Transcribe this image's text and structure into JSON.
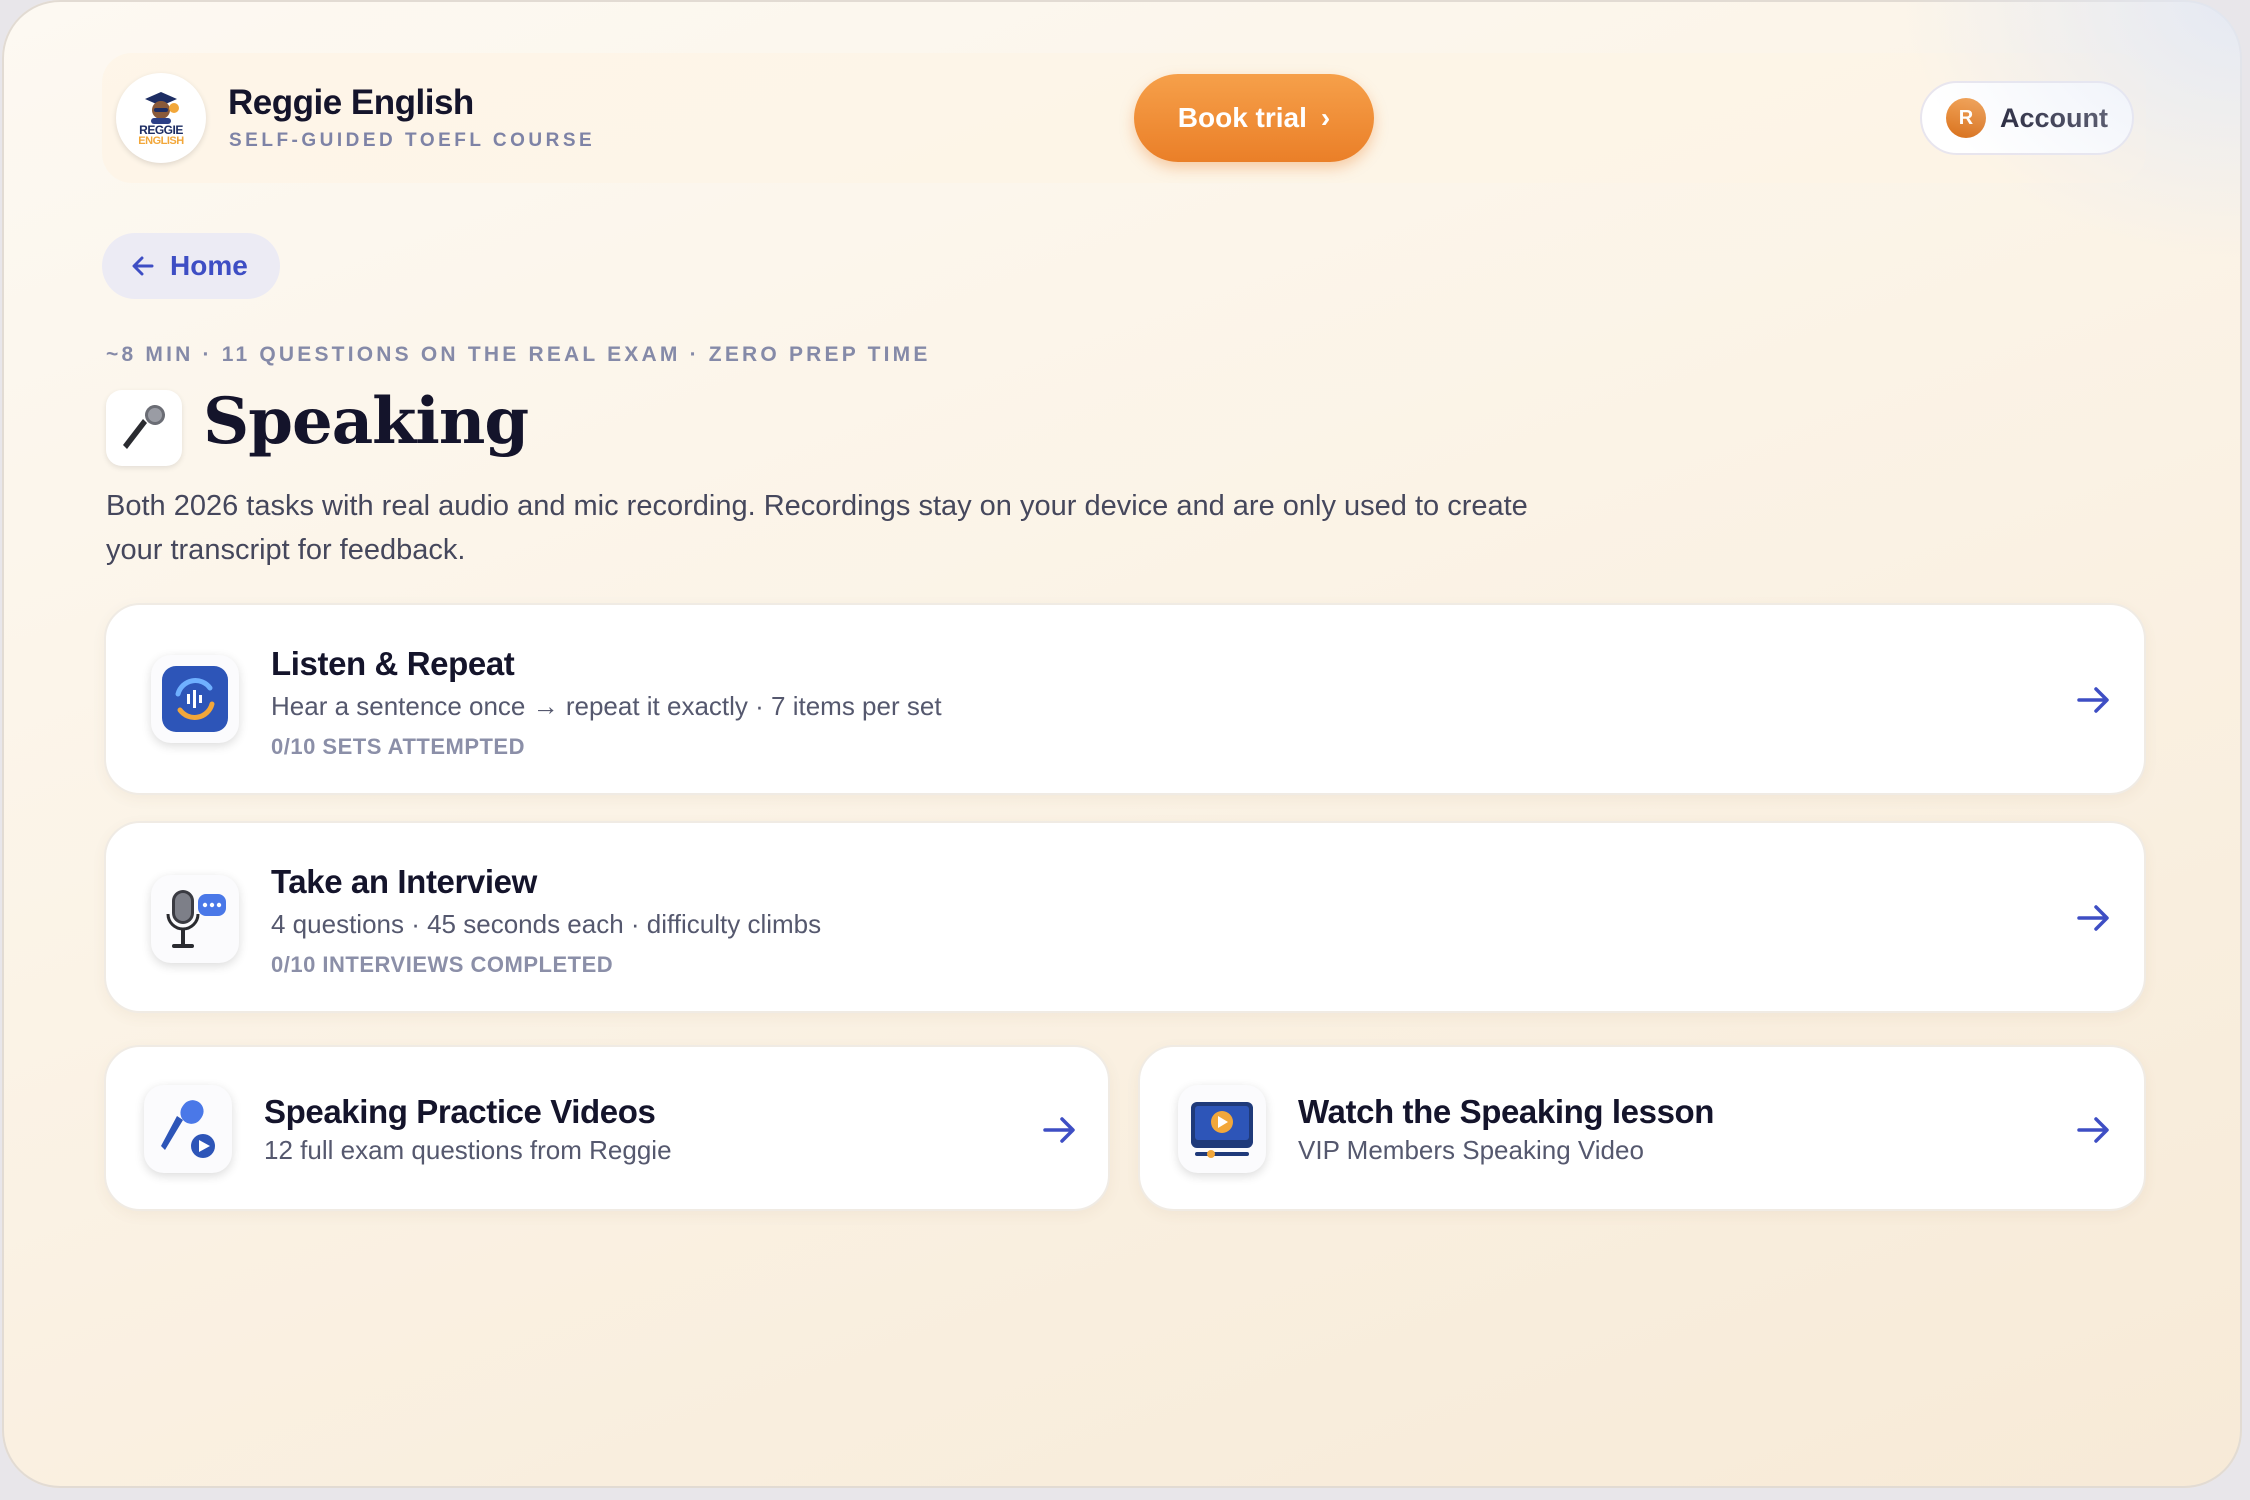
{
  "header": {
    "brand_title": "Reggie English",
    "brand_subtitle": "SELF-GUIDED TOEFL COURSE",
    "logo_text_top": "REGGIE",
    "logo_text_bottom": "ENGLISH",
    "book_label": "Book trial",
    "book_chevron": "›",
    "account_initial": "R",
    "account_label": "Account"
  },
  "nav": {
    "home_label": "Home"
  },
  "section": {
    "meta": "~8 MIN · 11 QUESTIONS ON THE REAL EXAM · ZERO PREP TIME",
    "title": "Speaking",
    "icon": "microphone-icon",
    "description": "Both 2026 tasks with real audio and mic recording. Recordings stay on your device and are only used to create your transcript for feedback."
  },
  "cards": [
    {
      "title": "Listen & Repeat",
      "subtitle": "Hear a sentence once → repeat it exactly · 7 items per set",
      "stat": "0/10 SETS ATTEMPTED",
      "icon": "listen-repeat-icon"
    },
    {
      "title": "Take an Interview",
      "subtitle": "4 questions · 45 seconds each · difficulty climbs",
      "stat": "0/10 INTERVIEWS COMPLETED",
      "icon": "interview-mic-icon"
    },
    {
      "title": "Speaking Practice Videos",
      "subtitle": "12 full exam questions from Reggie",
      "icon": "practice-video-mic-icon"
    },
    {
      "title": "Watch the Speaking lesson",
      "subtitle": "VIP Members Speaking Video",
      "icon": "lesson-video-icon"
    }
  ],
  "colors": {
    "accent": "#3e4ec4",
    "cta": "#ea7f28",
    "text": "#14142b"
  }
}
